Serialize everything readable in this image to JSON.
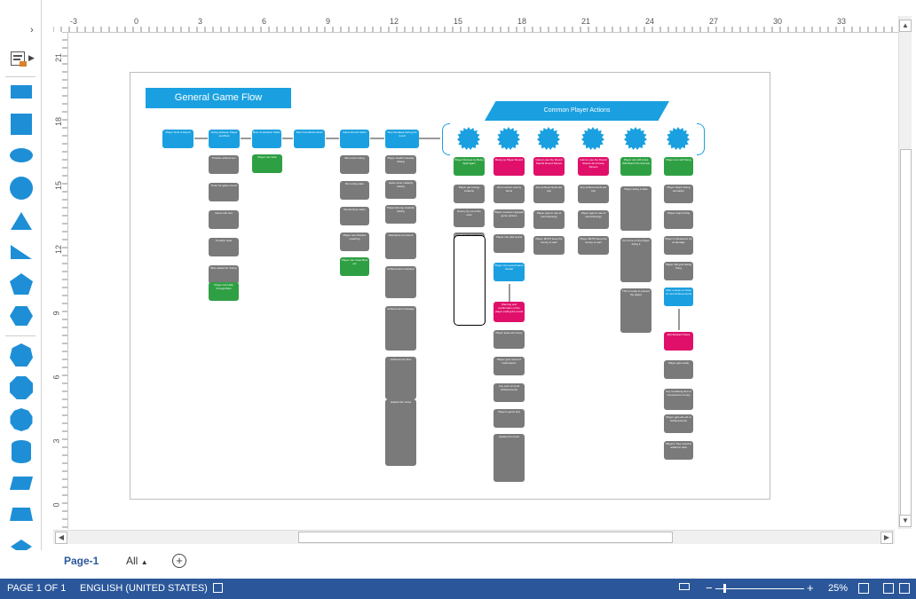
{
  "shapes_panel": {
    "expand_icon": "chevron-right-icon",
    "stencil_icon": "stencil-menu-icon",
    "shapes": [
      "rectangle",
      "square",
      "ellipse",
      "circle",
      "triangle",
      "right-triangle",
      "pentagon",
      "hexagon",
      "heptagon",
      "octagon",
      "decagon",
      "can",
      "parallelogram",
      "trapezoid",
      "diamond"
    ]
  },
  "ruler": {
    "top_labels": [
      "-3",
      "0",
      "3",
      "6",
      "9",
      "12",
      "15",
      "18",
      "21",
      "24",
      "27",
      "30",
      "33"
    ],
    "left_labels": [
      "21",
      "18",
      "15",
      "12",
      "9",
      "6",
      "3",
      "0"
    ]
  },
  "diagram": {
    "title": "General Game Flow",
    "banner": "Common Player Actions",
    "row_nodes": [
      "Player finds a Round",
      "Voting between Player and Bots",
      "Bots Countdown Starts",
      "Start Countdown Ends",
      "Game Round Starts",
      "Stop Sneaked during the round"
    ],
    "burst_nodes": [
      "Player Scales",
      "Player Round Skills",
      "Player Dies",
      "Some Time Runs Out",
      "Player Round Pass Any Time",
      "Player Round Pass Good Flowers"
    ],
    "col_a": [
      "Timeline shared text",
      "Timer for game round",
      "Game info text",
      "Timeline stats",
      "Bots waited for Voting"
    ],
    "col_a_green": "Player can Help through Bots",
    "col_b_green": "Player can Vote",
    "col_c": [
      "Bot-to-bot voting",
      "Bot voting stats",
      "Round timer starts",
      "Player can Practice Leapfrog"
    ],
    "col_c_green": "Player can Yeast Bots etc",
    "col_d": [
      "Player Health instantly ticking",
      "Game timer instantly ticking",
      "Player Energy instantly ticking",
      "Refreshes at content",
      "Achievement unlocked",
      "Achievement message",
      "Achievement flow",
      "Helpful info notes"
    ],
    "col_e_green": "Player Revives by Being Split Again",
    "col_e": [
      "Player get energy instantly",
      "Enemy fly out of the zone",
      "Cut Plants to the narrow slot"
    ],
    "col_f_pink": "Being up Player Round",
    "col_f": [
      "All on screen enemy items",
      "Player receives Upgrade game options",
      "Player can add sound"
    ],
    "col_f_blue": "Player can sound Game Global",
    "col_f_pink2": "Warning and confirmation of the player exiting the round",
    "col_f2": [
      "Player loses all money",
      "Player gets round of Gold tokens",
      "Any cost of round Achievements",
      "Player's game first",
      "Update bot errors"
    ],
    "col_g_pink": "Game Lose the Round Stands Round Stream",
    "col_g": [
      "Any achievements are lost",
      "Player gets to use of sound Energy",
      "Player MUST keep the money to earn"
    ],
    "col_h_pink": "Game Lose the Round Stands all of these Stream",
    "col_h": [
      "Any achievements are lost",
      "Player gets to use of sound Energy",
      "Player MUST keep the money to earn"
    ],
    "col_i_green": "Player can still score Will Board The Rounds",
    "col_i": [
      "Player doing it state",
      "For more on the player doing it",
      "This is ready to prevent the player"
    ],
    "col_j_green": "Player can still Swing",
    "col_j": [
      "Player Stops Swing animation",
      "Player stops Firing",
      "Player is Measured Up at damage",
      "Player still gets Swing firing",
      "Player gets ready"
    ],
    "col_j_blue": "After a steps on Drive Its next Achievements",
    "col_j_pink": "Exit Abstract Views",
    "col_j2": [
      "Player gets ready",
      "Any remaining time is converted to money",
      "Player gets all end to Achievements",
      "Player's Tree round to added to total"
    ]
  },
  "tabs": {
    "page_tab": "Page-1",
    "all_tab": "All",
    "add_page_icon": "plus-circle-icon"
  },
  "status": {
    "page": "PAGE 1 OF 1",
    "language": "ENGLISH (UNITED STATES)",
    "zoom": "25%"
  },
  "colors": {
    "accent_blue": "#1aa0e0",
    "status_bar": "#2b579a",
    "grey_node": "#7a7a7a",
    "green_node": "#2ea043",
    "pink_node": "#e0106a"
  }
}
